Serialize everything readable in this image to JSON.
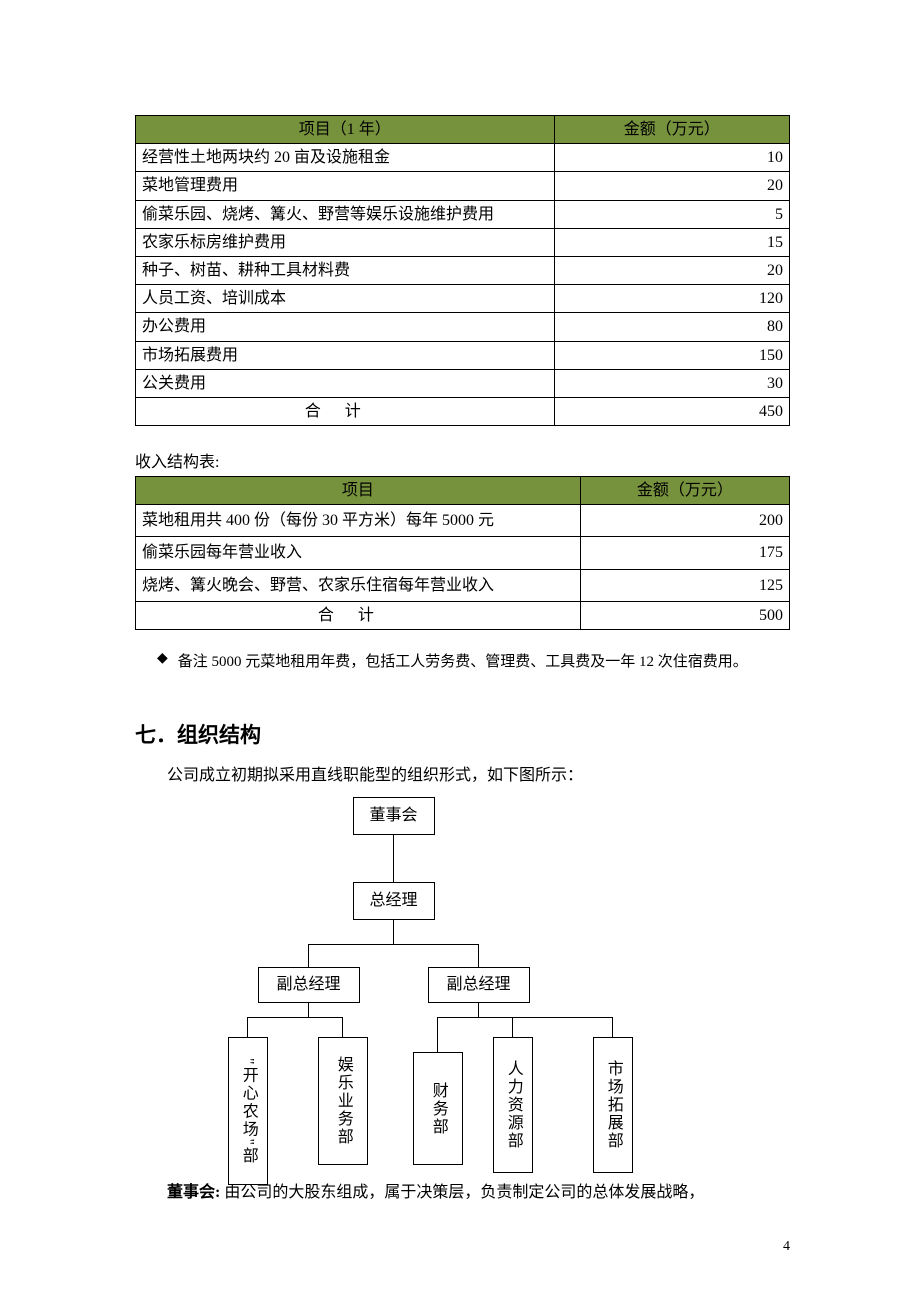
{
  "table1": {
    "headers": {
      "c1": "项目（1 年）",
      "c2": "金额（万元）"
    },
    "rows": [
      {
        "c1": "经营性土地两块约 20 亩及设施租金",
        "c2": "10"
      },
      {
        "c1": "菜地管理费用",
        "c2": "20"
      },
      {
        "c1": "偷菜乐园、烧烤、篝火、野营等娱乐设施维护费用",
        "c2": "5"
      },
      {
        "c1": "农家乐标房维护费用",
        "c2": "15"
      },
      {
        "c1": "种子、树苗、耕种工具材料费",
        "c2": "20"
      },
      {
        "c1": "人员工资、培训成本",
        "c2": "120"
      },
      {
        "c1": "办公费用",
        "c2": "80"
      },
      {
        "c1": "市场拓展费用",
        "c2": "150"
      },
      {
        "c1": "公关费用",
        "c2": "30"
      }
    ],
    "total": {
      "label": "合计",
      "value": "450"
    }
  },
  "table2_title": "收入结构表:",
  "table2": {
    "headers": {
      "c1": "项目",
      "c2": "金额（万元）"
    },
    "rows": [
      {
        "c1": "菜地租用共 400 份（每份 30 平方米）每年 5000 元",
        "c2": "200"
      },
      {
        "c1": "偷菜乐园每年营业收入",
        "c2": "175"
      },
      {
        "c1": "烧烤、篝火晚会、野营、农家乐住宿每年营业收入",
        "c2": "125"
      }
    ],
    "total": {
      "label": "合计",
      "value": "500"
    }
  },
  "note_bullet": "◆",
  "note_text": "备注 5000 元菜地租用年费，包括工人劳务费、管理费、工具费及一年 12 次住宿费用。",
  "section_title": "七．组织结构",
  "section_intro": "公司成立初期拟采用直线职能型的组织形式，如下图所示：",
  "org": {
    "board": "董事会",
    "gm": "总经理",
    "vp1": "副总经理",
    "vp2": "副总经理",
    "d1": "\"开心农场\"部",
    "d2": "娱乐业务部",
    "d3": "财务部",
    "d4": "人力资源部",
    "d5": "市场拓展部"
  },
  "board_para_label": "董事会:",
  "board_para_text": " 由公司的大股东组成，属于决策层，负责制定公司的总体发展战略，",
  "page_number": "4",
  "chart_data": {
    "type": "table",
    "tables": [
      {
        "title": "项目（1 年） / 金额（万元）",
        "columns": [
          "项目（1 年）",
          "金额（万元）"
        ],
        "rows": [
          [
            "经营性土地两块约 20 亩及设施租金",
            10
          ],
          [
            "菜地管理费用",
            20
          ],
          [
            "偷菜乐园、烧烤、篝火、野营等娱乐设施维护费用",
            5
          ],
          [
            "农家乐标房维护费用",
            15
          ],
          [
            "种子、树苗、耕种工具材料费",
            20
          ],
          [
            "人员工资、培训成本",
            120
          ],
          [
            "办公费用",
            80
          ],
          [
            "市场拓展费用",
            150
          ],
          [
            "公关费用",
            30
          ],
          [
            "合计",
            450
          ]
        ]
      },
      {
        "title": "收入结构表",
        "columns": [
          "项目",
          "金额（万元）"
        ],
        "rows": [
          [
            "菜地租用共 400 份（每份 30 平方米）每年 5000 元",
            200
          ],
          [
            "偷菜乐园每年营业收入",
            175
          ],
          [
            "烧烤、篝火晚会、野营、农家乐住宿每年营业收入",
            125
          ],
          [
            "合计",
            500
          ]
        ]
      }
    ],
    "org_chart": {
      "root": "董事会",
      "children": [
        {
          "name": "总经理",
          "children": [
            {
              "name": "副总经理",
              "children": [
                "\"开心农场\"部",
                "娱乐业务部"
              ]
            },
            {
              "name": "副总经理",
              "children": [
                "财务部",
                "人力资源部",
                "市场拓展部"
              ]
            }
          ]
        }
      ]
    }
  }
}
